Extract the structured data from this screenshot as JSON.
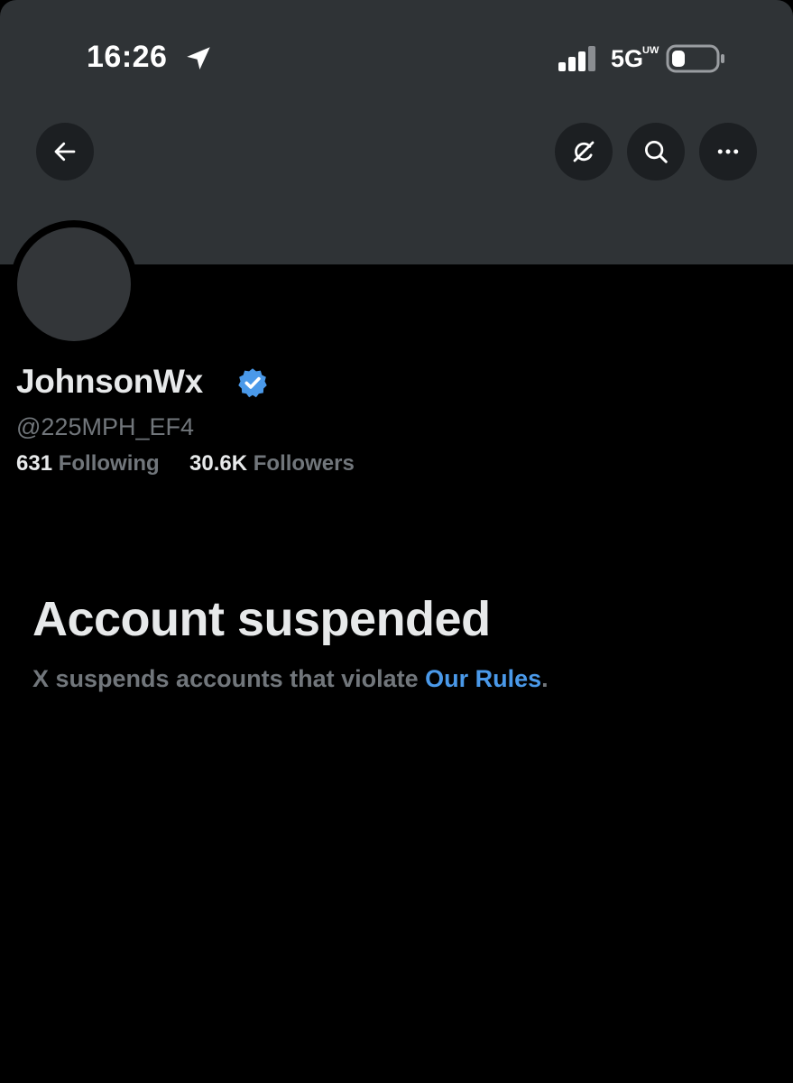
{
  "status_bar": {
    "time": "16:26",
    "network": "5G",
    "network_sub": "UW"
  },
  "header": {
    "back_icon": "arrow-left-icon",
    "buttons": [
      "grok-icon",
      "search-icon",
      "more-icon"
    ]
  },
  "profile": {
    "display_name": "JohnsonWx",
    "verified": true,
    "handle": "@225MPH_EF4",
    "following_count": "631",
    "following_label": "Following",
    "followers_count": "30.6K",
    "followers_label": "Followers"
  },
  "suspension": {
    "title": "Account suspended",
    "message_prefix": "X suspends accounts that violate ",
    "rules_link": "Our Rules",
    "message_suffix": "."
  },
  "colors": {
    "background": "#000000",
    "banner": "#2f3336",
    "primary_text": "#e7e9ea",
    "secondary_text": "#71767b",
    "link": "#4a99e9",
    "verified": "#4a99e9"
  }
}
